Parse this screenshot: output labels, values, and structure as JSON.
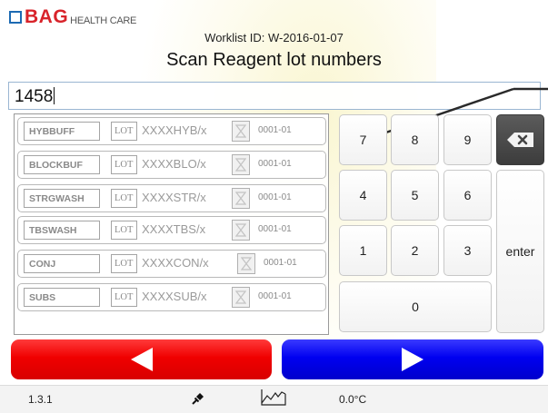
{
  "logo": {
    "brand": "BAG",
    "subtitle": "HEALTH CARE"
  },
  "worklist_label": "Worklist ID: W-2016-01-07",
  "title": "Scan Reagent lot numbers",
  "scan_input": {
    "value": "1458"
  },
  "reagents": [
    {
      "name": "HYBBUFF",
      "lot_tag": "LOT",
      "lot": "XXXXHYB/x",
      "date": "0001-01"
    },
    {
      "name": "BLOCKBUF",
      "lot_tag": "LOT",
      "lot": "XXXXBLO/x",
      "date": "0001-01"
    },
    {
      "name": "STRGWASH",
      "lot_tag": "LOT",
      "lot": "XXXXSTR/x",
      "date": "0001-01"
    },
    {
      "name": "TBSWASH",
      "lot_tag": "LOT",
      "lot": "XXXXTBS/x",
      "date": "0001-01"
    },
    {
      "name": "CONJ",
      "lot_tag": "LOT",
      "lot": "XXXXCON/x",
      "date": "0001-01"
    },
    {
      "name": "SUBS",
      "lot_tag": "LOT",
      "lot": "XXXXSUB/x",
      "date": "0001-01"
    }
  ],
  "keypad": {
    "k7": "7",
    "k8": "8",
    "k9": "9",
    "k4": "4",
    "k5": "5",
    "k6": "6",
    "k1": "1",
    "k2": "2",
    "k3": "3",
    "k0": "0",
    "enter": "enter",
    "backspace_icon": "backspace-icon"
  },
  "nav": {
    "back_icon": "arrow-left-icon",
    "next_icon": "arrow-right-icon"
  },
  "status": {
    "version": "1.3.1",
    "temperature": "0.0°C",
    "pin_icon": "pin-icon",
    "chart_icon": "chart-icon"
  },
  "colors": {
    "back_button": "#f00000",
    "next_button": "#0000f0",
    "brand_red": "#d8232a",
    "brand_blue": "#1c6ab3"
  }
}
